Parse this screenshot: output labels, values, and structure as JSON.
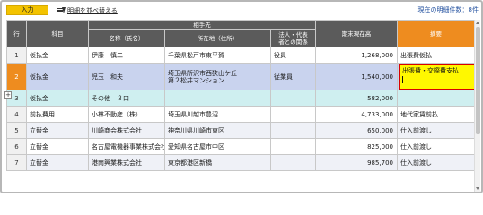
{
  "toolbar": {
    "mode_tab": "入力",
    "sort_label": "明細を並べ替える",
    "count_prefix": "現在の明細件数：",
    "count_value": "8",
    "count_suffix": "件"
  },
  "columns": {
    "row": "行",
    "account": "科目",
    "partner_group": "相手先",
    "name": "名称（氏名）",
    "address": "所在地（住所）",
    "relation_line1": "法人・代表",
    "relation_line2": "者との関係",
    "balance": "期末現在高",
    "summary": "摘要"
  },
  "rows": [
    {
      "num": "1",
      "account": "仮払金",
      "name": "伊藤　慎二",
      "address": "千葉県松戸市東平賀",
      "address2": "",
      "relation": "役員",
      "balance": "1,268,000",
      "summary": "出張費仮払"
    },
    {
      "num": "2",
      "account": "仮払金",
      "name": "児玉　和夫",
      "address": "埼玉県所沢市西狭山ケ丘",
      "address2": "第２松井マンション",
      "relation": "従業員",
      "balance": "1,540,000",
      "summary": "出張費・交際費支払"
    },
    {
      "num": "3",
      "account": "仮払金",
      "name": "その他　３口",
      "address": "",
      "address2": "",
      "relation": "",
      "balance": "582,000",
      "summary": ""
    },
    {
      "num": "4",
      "account": "前払費用",
      "name": "小林不動産（株）",
      "address": "埼玉県川越市豊沼",
      "address2": "",
      "relation": "",
      "balance": "4,733,000",
      "summary": "地代家賃前払"
    },
    {
      "num": "5",
      "account": "立替金",
      "name": "川崎商会株式会社",
      "address": "神奈川県川崎市東区",
      "address2": "",
      "relation": "",
      "balance": "650,000",
      "summary": "仕入前渡し"
    },
    {
      "num": "6",
      "account": "立替金",
      "name": "名古屋電機器事業株式会社",
      "address": "愛知県名古屋市中区",
      "address2": "",
      "relation": "",
      "balance": "825,000",
      "summary": "仕入前渡し"
    },
    {
      "num": "7",
      "account": "立替金",
      "name": "港南興業株式会社",
      "address": "東京都港区新橋",
      "address2": "",
      "relation": "",
      "balance": "985,700",
      "summary": "仕入前渡し"
    }
  ],
  "expander_glyph": "+",
  "colors": {
    "header": "#5b5b5b",
    "summary_header": "#ee8c1f",
    "selected_row": "#c9d3ee",
    "sub_row": "#cfeff0",
    "edit_box": "#fff800",
    "edit_border": "#d80000",
    "mode_tab": "#f3c300"
  }
}
